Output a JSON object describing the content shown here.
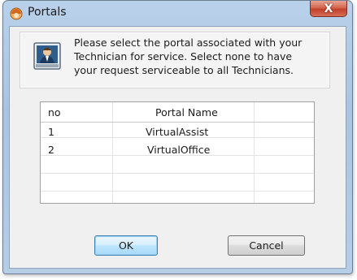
{
  "window": {
    "title": "Portals",
    "close_glyph": "X"
  },
  "info": {
    "message": "Please select the portal associated with your Technician for service. Select none to have your request serviceable to all Technicians."
  },
  "table": {
    "headers": [
      "no",
      "Portal Name"
    ],
    "rows": [
      {
        "no": "1",
        "name": "VirtualAssist"
      },
      {
        "no": "2",
        "name": "VirtualOffice"
      }
    ]
  },
  "buttons": {
    "ok": "OK",
    "cancel": "Cancel"
  },
  "icons": {
    "app": "portal-app-icon",
    "technician": "technician-icon"
  }
}
